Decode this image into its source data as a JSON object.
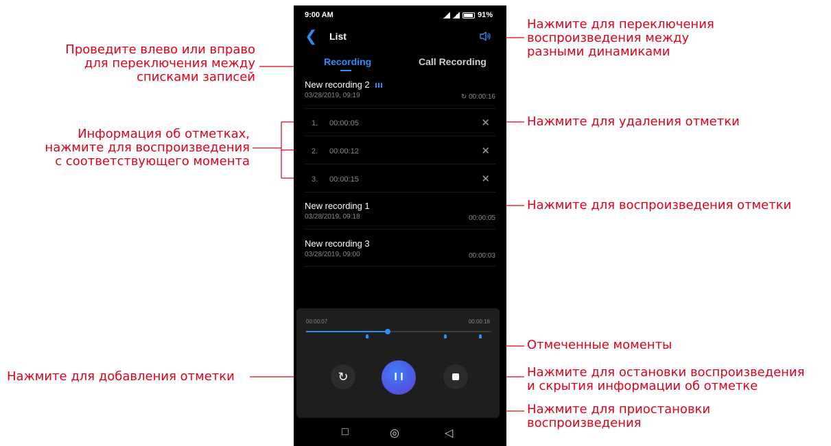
{
  "annotations": {
    "swipe": "Проведите влево или вправо\nдля переключения между\nсписками записей",
    "speaker": "Нажмите для переключения\nвоспроизведения между\nразными динамиками",
    "mark_info": "Информация об отметках,\nнажмите для воспроизведения\nс соответствующего момента",
    "delete_mark": "Нажмите для удаления отметки",
    "play_mark": "Нажмите для воспроизведения отметки",
    "marked_moments": "Отмеченные моменты",
    "add_mark": "Нажмите для добавления отметки",
    "stop": "Нажмите для остановки воспроизведения\nи скрытия информации об отметке",
    "pause": "Нажмите для приостановки\nвоспроизведения"
  },
  "status_bar": {
    "time": "9:00 AM",
    "battery": "91%"
  },
  "header": {
    "title": "List"
  },
  "tabs": [
    {
      "label": "Recording"
    },
    {
      "label": "Call Recording"
    }
  ],
  "recordings": [
    {
      "name": "New recording 2",
      "date": "03/28/2019, 09:19",
      "duration": "00:00:16"
    },
    {
      "name": "New recording 1",
      "date": "03/28/2019, 09:18",
      "duration": "00:00:05"
    },
    {
      "name": "New recording 3",
      "date": "03/28/2019, 09:00",
      "duration": "00:00:03"
    }
  ],
  "marks": [
    {
      "index": "1.",
      "time": "00:00:05"
    },
    {
      "index": "2.",
      "time": "00:00:12"
    },
    {
      "index": "3.",
      "time": "00:00:15"
    }
  ],
  "player": {
    "current_time": "00:00:07",
    "total_time": "00:00:16",
    "progress": 0.44,
    "mark_positions": [
      0.33,
      0.75,
      0.94
    ]
  },
  "colors": {
    "accent": "#2e8cf6",
    "annotation": "#e2001a"
  }
}
